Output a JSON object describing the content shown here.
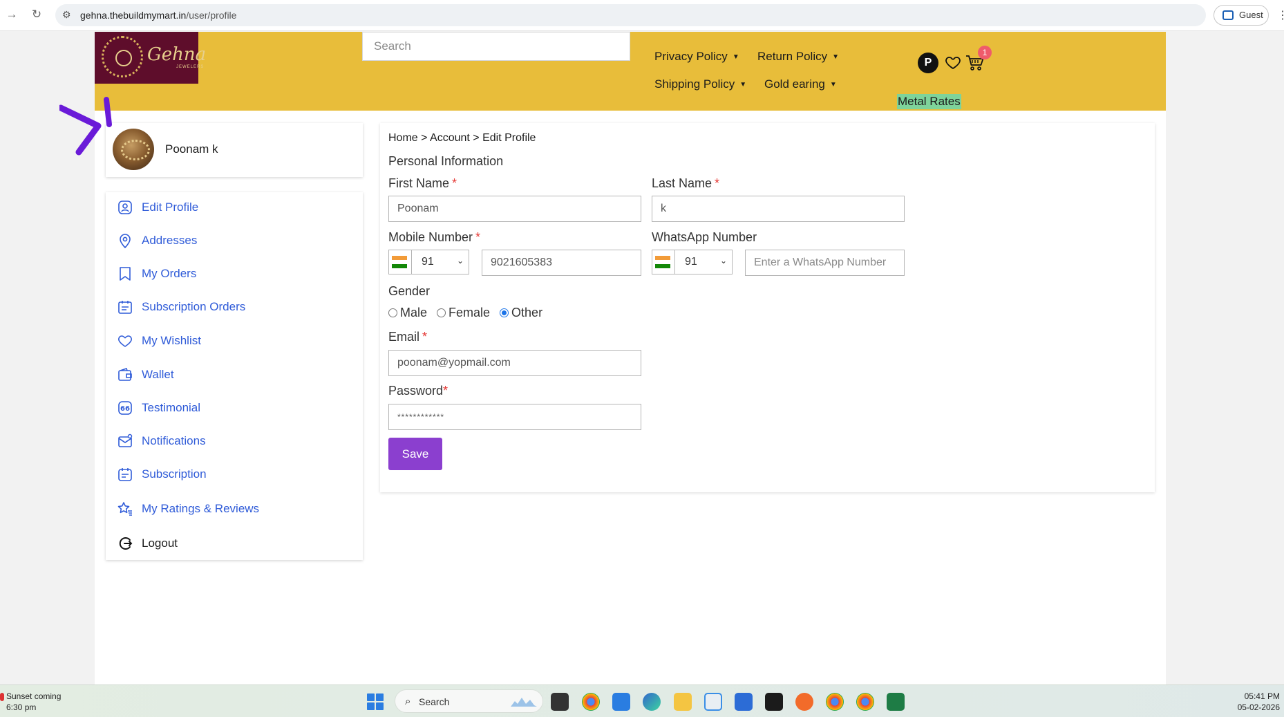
{
  "browser": {
    "url_host": "gehna.thebuildmymart.in",
    "url_path": "/user/profile",
    "profile_label": "Guest"
  },
  "header": {
    "logo_text": "Gehna",
    "logo_sub": "JEWELERS",
    "search_placeholder": "Search",
    "nav": [
      {
        "label": "Privacy Policy"
      },
      {
        "label": "Return Policy"
      },
      {
        "label": "Shipping Policy"
      },
      {
        "label": "Gold earing"
      }
    ],
    "user_initial": "P",
    "cart_count": "1",
    "metal_rates": "Metal Rates"
  },
  "sidebar": {
    "user_name": "Poonam k",
    "items": [
      {
        "label": "Edit Profile",
        "icon": "user-icon"
      },
      {
        "label": "Addresses",
        "icon": "location-pin-icon"
      },
      {
        "label": "My Orders",
        "icon": "bookmark-icon"
      },
      {
        "label": "Subscription Orders",
        "icon": "calendar-list-icon"
      },
      {
        "label": "My Wishlist",
        "icon": "heart-icon"
      },
      {
        "label": "Wallet",
        "icon": "wallet-icon"
      },
      {
        "label": "Testimonial",
        "icon": "quote-icon"
      },
      {
        "label": "Notifications",
        "icon": "envelope-icon"
      },
      {
        "label": "Subscription",
        "icon": "subscription-icon"
      },
      {
        "label": "My Ratings & Reviews",
        "icon": "star-icon"
      },
      {
        "label": "Logout",
        "icon": "logout-icon"
      }
    ]
  },
  "form": {
    "breadcrumb": "Home > Account > Edit Profile",
    "section_title": "Personal Information",
    "first_name_label": "First Name",
    "first_name_value": "Poonam",
    "last_name_label": "Last Name",
    "last_name_value": "k",
    "mobile_label": "Mobile Number",
    "mobile_code": "91",
    "mobile_value": "9021605383",
    "whatsapp_label": "WhatsApp Number",
    "whatsapp_code": "91",
    "whatsapp_placeholder": "Enter a WhatsApp Number",
    "gender_label": "Gender",
    "gender_options": [
      {
        "label": "Male"
      },
      {
        "label": "Female"
      },
      {
        "label": "Other"
      }
    ],
    "gender_selected": "Other",
    "email_label": "Email",
    "email_value": "poonam@yopmail.com",
    "password_label": "Password",
    "password_value": "************",
    "required_mark": "*",
    "save_label": "Save"
  },
  "taskbar": {
    "weather_title": "Sunset coming",
    "weather_time": "6:30 pm",
    "search_label": "Search",
    "clock_time": "05:41 PM",
    "clock_date": "05-02-2026"
  },
  "colors": {
    "header_bg": "#e8bd3a",
    "logo_bg": "#5e0d2b",
    "link_blue": "#2f5bd8",
    "save_purple": "#8b3fcf",
    "metal_rates_bg": "#7ed39a",
    "badge_red": "#ef5b6b"
  }
}
